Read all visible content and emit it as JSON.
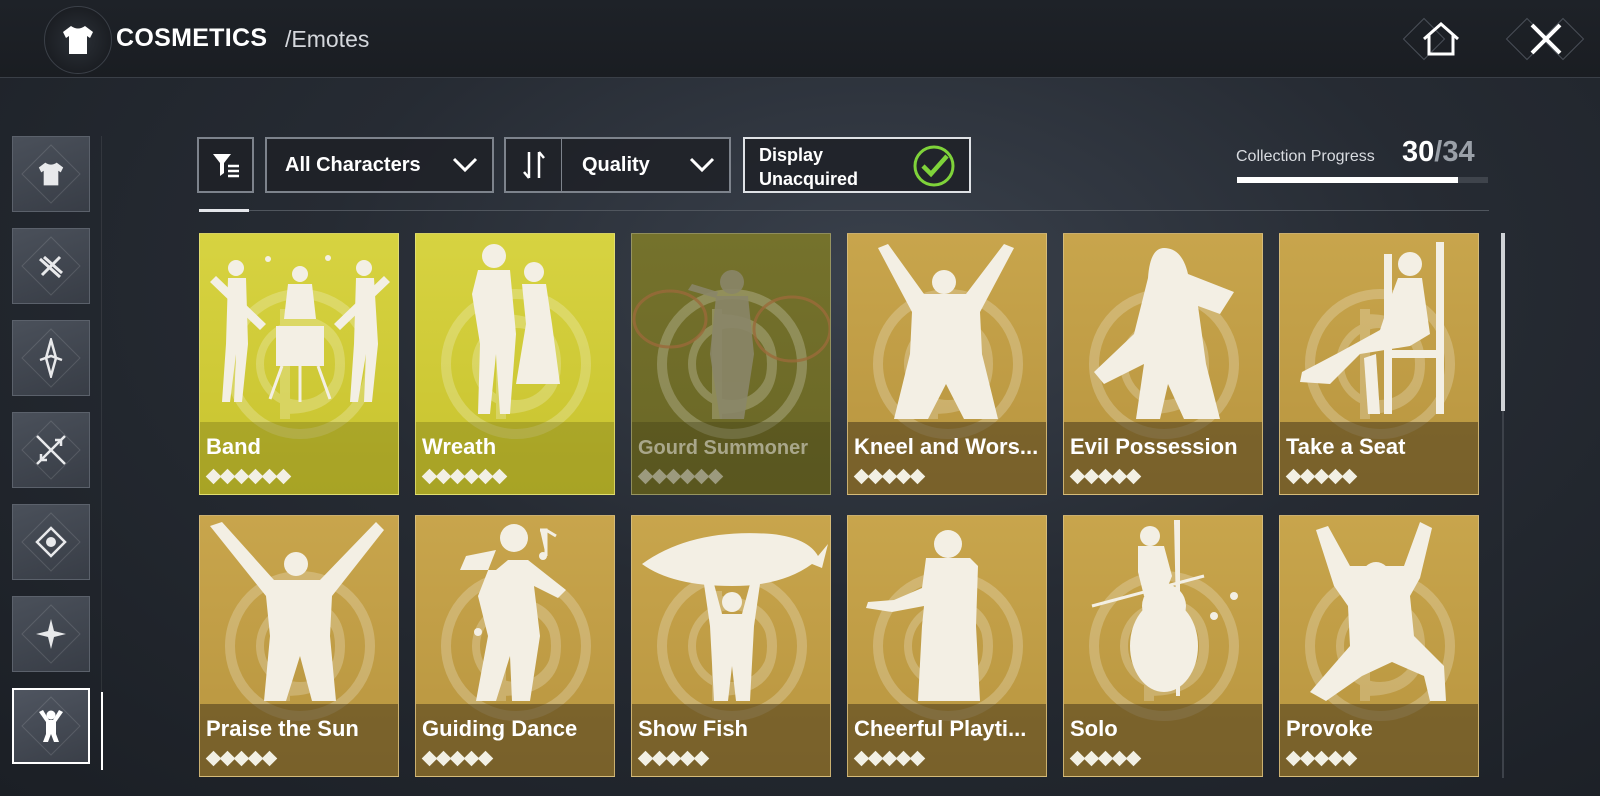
{
  "header": {
    "title": "COSMETICS",
    "subtitle": "/Emotes",
    "emblem_icon": "shirt-icon",
    "home_icon": "home-icon",
    "close_icon": "close-icon"
  },
  "sidebar": {
    "items": [
      {
        "icon": "shirt-icon",
        "active": false
      },
      {
        "icon": "weapon-skin-icon",
        "active": false
      },
      {
        "icon": "dagger-icon",
        "active": false
      },
      {
        "icon": "crossed-swords-icon",
        "active": false
      },
      {
        "icon": "emblem-icon",
        "active": false
      },
      {
        "icon": "compass-star-icon",
        "active": false
      },
      {
        "icon": "emote-pose-icon",
        "active": true
      }
    ]
  },
  "toolbar": {
    "filter_icon": "filter-icon",
    "characters_label": "All Characters",
    "sort_icon": "sort-icon",
    "quality_label": "Quality",
    "toggle_line1": "Display",
    "toggle_line2": "Unacquired",
    "toggle_checked": true
  },
  "progress": {
    "label": "Collection Progress",
    "current": "30",
    "separator": "/",
    "total": "34",
    "fraction": 0.882
  },
  "colors": {
    "gold": "#c8a54c",
    "yellow": "#d7d341",
    "check_green": "#7fd33a"
  },
  "emotes": [
    {
      "name": "Band",
      "stars": 6,
      "style": "yellow"
    },
    {
      "name": "Wreath",
      "stars": 6,
      "style": "yellow"
    },
    {
      "name": "Gourd Summoner",
      "stars": 6,
      "style": "dim"
    },
    {
      "name": "Kneel and Wors...",
      "stars": 5,
      "style": "gold"
    },
    {
      "name": "Evil Possession",
      "stars": 5,
      "style": "gold"
    },
    {
      "name": "Take a Seat",
      "stars": 5,
      "style": "gold"
    },
    {
      "name": "Praise the Sun",
      "stars": 5,
      "style": "gold"
    },
    {
      "name": "Guiding Dance",
      "stars": 5,
      "style": "gold"
    },
    {
      "name": "Show Fish",
      "stars": 5,
      "style": "gold"
    },
    {
      "name": "Cheerful Playti...",
      "stars": 5,
      "style": "gold"
    },
    {
      "name": "Solo",
      "stars": 5,
      "style": "gold"
    },
    {
      "name": "Provoke",
      "stars": 5,
      "style": "gold"
    }
  ]
}
